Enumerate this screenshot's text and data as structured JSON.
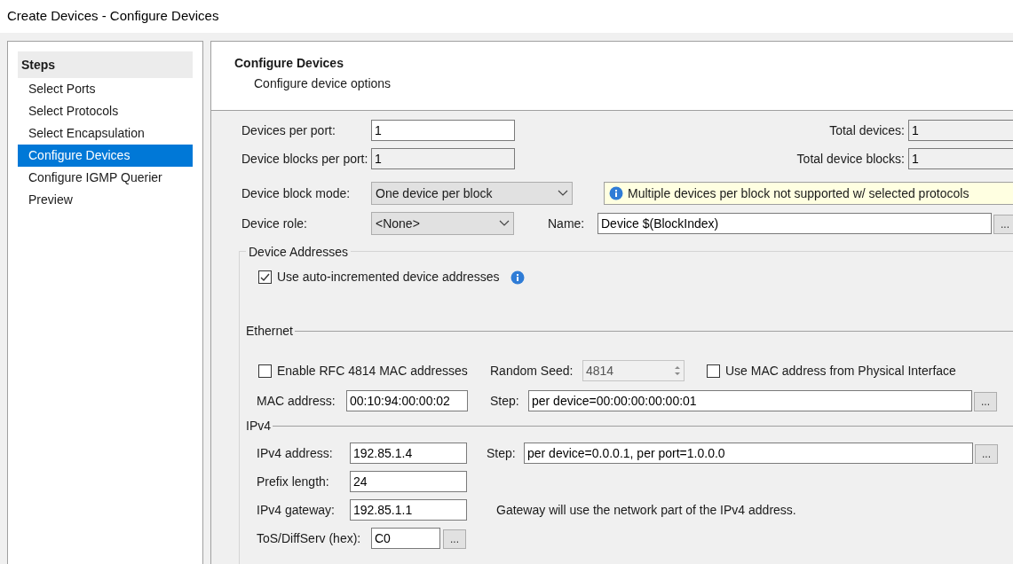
{
  "window": {
    "title": "Create Devices - Configure Devices"
  },
  "steps": {
    "heading": "Steps",
    "items": [
      {
        "label": "Select Ports",
        "selected": false
      },
      {
        "label": "Select Protocols",
        "selected": false
      },
      {
        "label": "Select Encapsulation",
        "selected": false
      },
      {
        "label": "Configure Devices",
        "selected": true
      },
      {
        "label": "Configure IGMP Querier",
        "selected": false
      },
      {
        "label": "Preview",
        "selected": false
      }
    ]
  },
  "header": {
    "title": "Configure Devices",
    "subtitle": "Configure device options"
  },
  "devices_per_port": {
    "label": "Devices per port:",
    "value": "1"
  },
  "device_blocks_per_port": {
    "label": "Device blocks per port:",
    "value": "1",
    "disabled": true
  },
  "total_devices": {
    "label": "Total devices:",
    "value": "1"
  },
  "total_device_blocks": {
    "label": "Total device blocks:",
    "value": "1"
  },
  "device_block_mode": {
    "label": "Device block mode:",
    "value": "One device per block"
  },
  "info_message": "Multiple devices per block not supported w/ selected protocols",
  "device_role": {
    "label": "Device role:",
    "value": "<None>"
  },
  "name": {
    "label": "Name:",
    "value": "Device $(BlockIndex)",
    "button": "..."
  },
  "device_addresses": {
    "title": "Device Addresses",
    "auto_increment": {
      "label": "Use auto-incremented device addresses",
      "checked": true
    }
  },
  "ethernet": {
    "title": "Ethernet",
    "rfc4814": {
      "label": "Enable RFC 4814 MAC addresses",
      "checked": false
    },
    "random_seed": {
      "label": "Random Seed:",
      "value": "4814",
      "disabled": true
    },
    "use_physical_mac": {
      "label": "Use MAC address from Physical Interface",
      "checked": false
    },
    "mac_address": {
      "label": "MAC address:",
      "value": "00:10:94:00:00:02"
    },
    "step": {
      "label": "Step:",
      "value": "per device=00:00:00:00:00:01",
      "button": "..."
    }
  },
  "ipv4": {
    "title": "IPv4",
    "address": {
      "label": "IPv4 address:",
      "value": "192.85.1.4"
    },
    "step": {
      "label": "Step:",
      "value": "per device=0.0.0.1, per port=1.0.0.0",
      "button": "..."
    },
    "prefix_length": {
      "label": "Prefix length:",
      "value": "24"
    },
    "gateway": {
      "label": "IPv4 gateway:",
      "value": "192.85.1.1"
    },
    "gateway_note": "Gateway will use the network part of the IPv4 address.",
    "tos": {
      "label": "ToS/DiffServ (hex):",
      "value": "C0",
      "button": "..."
    }
  }
}
